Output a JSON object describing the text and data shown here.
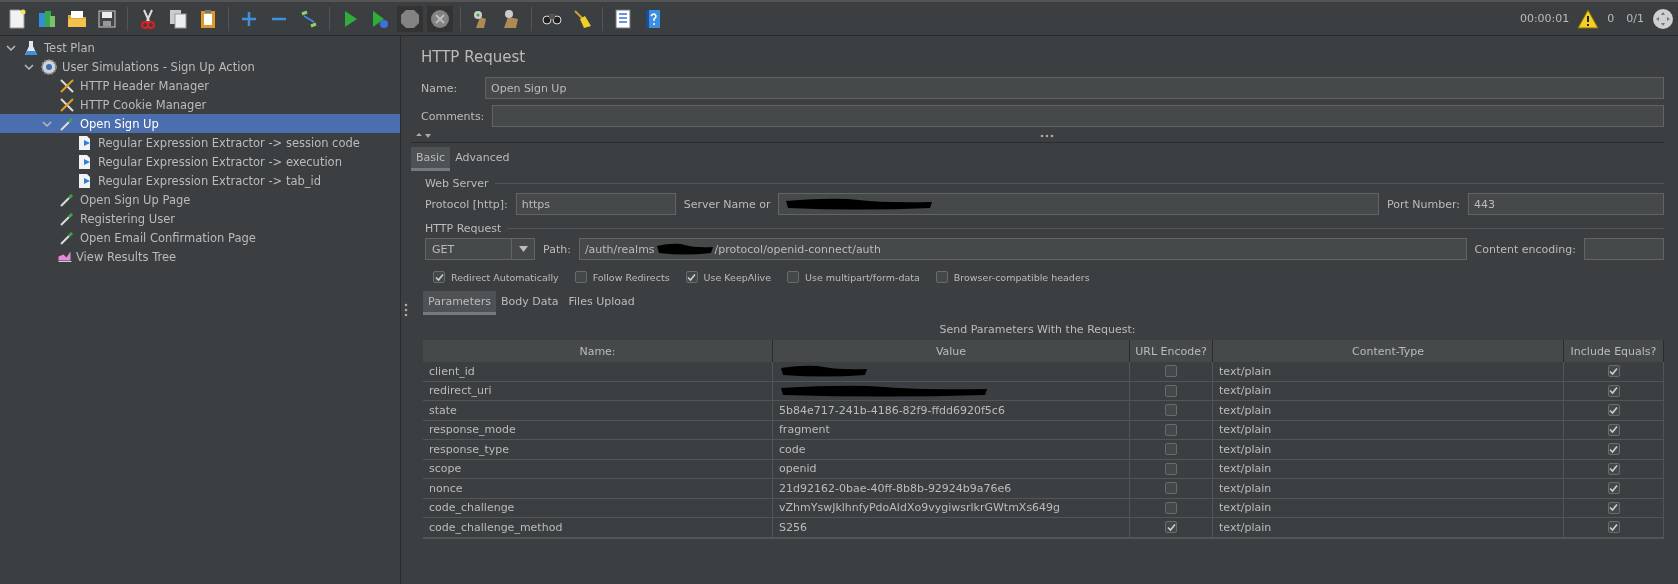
{
  "toolbar": [
    [
      {
        "kind": "new",
        "disabled": false
      },
      {
        "kind": "templates",
        "disabled": false
      },
      {
        "kind": "open",
        "disabled": false
      },
      {
        "kind": "save",
        "disabled": false
      }
    ],
    [
      {
        "kind": "cut",
        "disabled": false
      },
      {
        "kind": "copy",
        "disabled": false
      },
      {
        "kind": "paste",
        "disabled": false
      }
    ],
    [
      {
        "kind": "expand",
        "disabled": false
      },
      {
        "kind": "collapse",
        "disabled": false
      },
      {
        "kind": "toggle",
        "disabled": false
      }
    ],
    [
      {
        "kind": "start",
        "disabled": false
      },
      {
        "kind": "start-no-pause",
        "disabled": false
      },
      {
        "kind": "stop",
        "disabled": true
      },
      {
        "kind": "shutdown",
        "disabled": true
      }
    ],
    [
      {
        "kind": "clear",
        "disabled": false
      },
      {
        "kind": "clear-all",
        "disabled": false
      }
    ],
    [
      {
        "kind": "search",
        "disabled": false
      },
      {
        "kind": "reset-search",
        "disabled": false
      }
    ],
    [
      {
        "kind": "functions",
        "disabled": false
      },
      {
        "kind": "help",
        "disabled": false
      }
    ]
  ],
  "status": {
    "timer": "00:00:01",
    "warnings": "0",
    "threads": "0/1"
  },
  "tree": [
    {
      "label": "Test Plan",
      "kind": "plan",
      "expanded": true,
      "selected": false,
      "children": [
        {
          "label": "User Simulations - Sign Up Action",
          "kind": "thread-group",
          "expanded": true,
          "selected": false,
          "children": [
            {
              "label": "HTTP Header Manager",
              "kind": "config",
              "selected": false
            },
            {
              "label": "HTTP Cookie Manager",
              "kind": "config",
              "selected": false
            },
            {
              "label": "Open Sign Up",
              "kind": "sampler",
              "expanded": true,
              "selected": true,
              "children": [
                {
                  "label": "Regular Expression Extractor -> session code",
                  "kind": "extractor",
                  "selected": false
                },
                {
                  "label": "Regular Expression Extractor -> execution",
                  "kind": "extractor",
                  "selected": false
                },
                {
                  "label": "Regular Expression Extractor -> tab_id",
                  "kind": "extractor",
                  "selected": false
                }
              ]
            },
            {
              "label": "Open Sign Up Page",
              "kind": "sampler",
              "selected": false
            },
            {
              "label": "Registering User",
              "kind": "sampler",
              "selected": false
            },
            {
              "label": "Open Email Confirmation Page",
              "kind": "sampler",
              "selected": false
            },
            {
              "label": "View Results Tree",
              "kind": "listener",
              "selected": false
            }
          ]
        }
      ]
    }
  ],
  "panel": {
    "title": "HTTP Request",
    "name_label": "Name:",
    "name_value": "Open Sign Up",
    "comments_label": "Comments:",
    "tabs": [
      {
        "label": "Basic",
        "selected": true
      },
      {
        "label": "Advanced",
        "selected": false
      }
    ],
    "web_server": {
      "legend": "Web Server",
      "protocol_label": "Protocol [http]:",
      "protocol_value": "https",
      "server_label": "Server Name or",
      "server_redacted": true,
      "port_label": "Port Number:",
      "port_value": "443"
    },
    "http_request": {
      "legend": "HTTP Request",
      "method": "GET",
      "path_label": "Path:",
      "path_start": "/auth/realms",
      "path_redacted": true,
      "path_end": "/protocol/openid-connect/auth",
      "encoding_label": "Content encoding:"
    },
    "options": [
      {
        "label": "Redirect Automatically",
        "checked": true
      },
      {
        "label": "Follow Redirects",
        "checked": false
      },
      {
        "label": "Use KeepAlive",
        "checked": true
      },
      {
        "label": "Use multipart/form-data",
        "checked": false
      },
      {
        "label": "Browser-compatible headers",
        "checked": false
      }
    ],
    "sub_tabs": [
      {
        "label": "Parameters",
        "selected": true
      },
      {
        "label": "Body Data",
        "selected": false
      },
      {
        "label": "Files Upload",
        "selected": false
      }
    ],
    "params": {
      "caption": "Send Parameters With the Request:",
      "columns": [
        "Name:",
        "Value",
        "URL Encode?",
        "Content-Type",
        "Include Equals?"
      ],
      "rows": [
        {
          "name": "client_id",
          "redacted": true,
          "url_encode": false,
          "content_type": "text/plain",
          "include_equals": true
        },
        {
          "name": "redirect_uri",
          "redacted": true,
          "url_encode": false,
          "content_type": "text/plain",
          "include_equals": true
        },
        {
          "name": "state",
          "value": "5b84e717-241b-4186-82f9-ffdd6920f5c6",
          "url_encode": false,
          "content_type": "text/plain",
          "include_equals": true
        },
        {
          "name": "response_mode",
          "value": "fragment",
          "url_encode": false,
          "content_type": "text/plain",
          "include_equals": true
        },
        {
          "name": "response_type",
          "value": "code",
          "url_encode": false,
          "content_type": "text/plain",
          "include_equals": true
        },
        {
          "name": "scope",
          "value": "openid",
          "url_encode": false,
          "content_type": "text/plain",
          "include_equals": true
        },
        {
          "name": "nonce",
          "value": "21d92162-0bae-40ff-8b8b-92924b9a76e6",
          "url_encode": false,
          "content_type": "text/plain",
          "include_equals": true
        },
        {
          "name": "code_challenge",
          "value": "vZhmYswJklhnfyPdoAldXo9vygiwsrlkrGWtmXs649g",
          "url_encode": false,
          "content_type": "text/plain",
          "include_equals": true
        },
        {
          "name": "code_challenge_method",
          "value": "S256",
          "url_encode": true,
          "content_type": "text/plain",
          "include_equals": true
        }
      ]
    }
  }
}
